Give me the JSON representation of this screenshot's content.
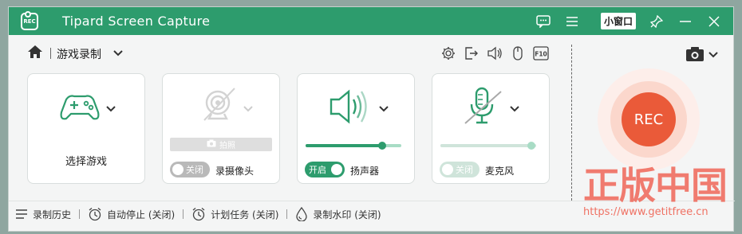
{
  "window": {
    "title": "Tipard Screen Capture",
    "logo_text": "REC"
  },
  "titlebar": {
    "mini_window_label": "小窗口"
  },
  "toolbar": {
    "mode_label": "游戏录制"
  },
  "cards": {
    "game": {
      "label": "选择游戏"
    },
    "webcam": {
      "label": "录摄像头",
      "toggle_text": "关闭",
      "photo_label": "拍照"
    },
    "speaker": {
      "label": "扬声器",
      "toggle_text": "开启",
      "volume": 0.8
    },
    "mic": {
      "label": "麦克风",
      "toggle_text": "关闭",
      "volume": 0.95
    }
  },
  "rec": {
    "label": "REC"
  },
  "bottom": {
    "history": "录制历史",
    "auto_stop": "自动停止 (关闭)",
    "schedule": "计划任务 (关闭)",
    "watermark": "录制水印 (关闭)"
  },
  "overlay": {
    "watermark_text": "正版中国",
    "watermark_url": "https://www.getitfree.cn"
  },
  "colors": {
    "accent": "#2d9c6d",
    "rec": "#ea5a39",
    "watermark": "#ef5a4a"
  }
}
